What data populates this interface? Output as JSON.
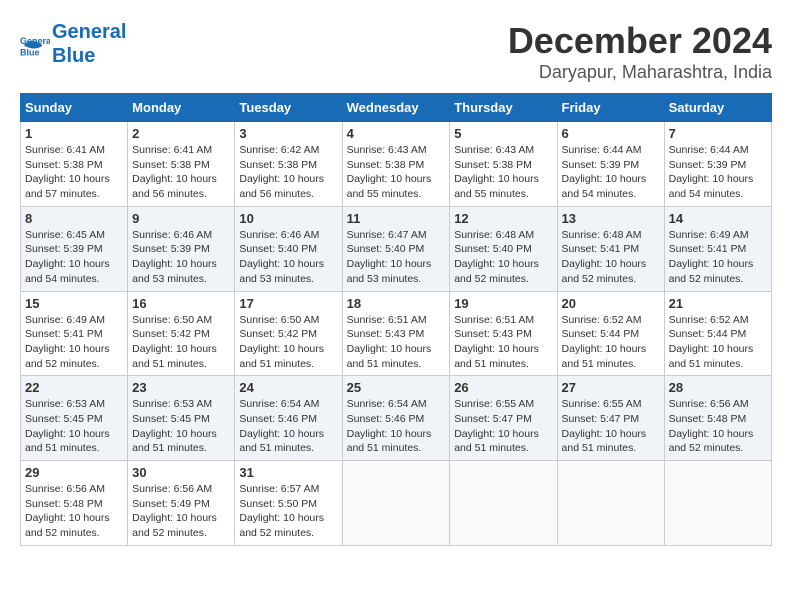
{
  "logo": {
    "line1": "General",
    "line2": "Blue"
  },
  "title": "December 2024",
  "subtitle": "Daryapur, Maharashtra, India",
  "days_of_week": [
    "Sunday",
    "Monday",
    "Tuesday",
    "Wednesday",
    "Thursday",
    "Friday",
    "Saturday"
  ],
  "weeks": [
    [
      {
        "day": "1",
        "sunrise": "6:41 AM",
        "sunset": "5:38 PM",
        "daylight": "10 hours and 57 minutes."
      },
      {
        "day": "2",
        "sunrise": "6:41 AM",
        "sunset": "5:38 PM",
        "daylight": "10 hours and 56 minutes."
      },
      {
        "day": "3",
        "sunrise": "6:42 AM",
        "sunset": "5:38 PM",
        "daylight": "10 hours and 56 minutes."
      },
      {
        "day": "4",
        "sunrise": "6:43 AM",
        "sunset": "5:38 PM",
        "daylight": "10 hours and 55 minutes."
      },
      {
        "day": "5",
        "sunrise": "6:43 AM",
        "sunset": "5:38 PM",
        "daylight": "10 hours and 55 minutes."
      },
      {
        "day": "6",
        "sunrise": "6:44 AM",
        "sunset": "5:39 PM",
        "daylight": "10 hours and 54 minutes."
      },
      {
        "day": "7",
        "sunrise": "6:44 AM",
        "sunset": "5:39 PM",
        "daylight": "10 hours and 54 minutes."
      }
    ],
    [
      {
        "day": "8",
        "sunrise": "6:45 AM",
        "sunset": "5:39 PM",
        "daylight": "10 hours and 54 minutes."
      },
      {
        "day": "9",
        "sunrise": "6:46 AM",
        "sunset": "5:39 PM",
        "daylight": "10 hours and 53 minutes."
      },
      {
        "day": "10",
        "sunrise": "6:46 AM",
        "sunset": "5:40 PM",
        "daylight": "10 hours and 53 minutes."
      },
      {
        "day": "11",
        "sunrise": "6:47 AM",
        "sunset": "5:40 PM",
        "daylight": "10 hours and 53 minutes."
      },
      {
        "day": "12",
        "sunrise": "6:48 AM",
        "sunset": "5:40 PM",
        "daylight": "10 hours and 52 minutes."
      },
      {
        "day": "13",
        "sunrise": "6:48 AM",
        "sunset": "5:41 PM",
        "daylight": "10 hours and 52 minutes."
      },
      {
        "day": "14",
        "sunrise": "6:49 AM",
        "sunset": "5:41 PM",
        "daylight": "10 hours and 52 minutes."
      }
    ],
    [
      {
        "day": "15",
        "sunrise": "6:49 AM",
        "sunset": "5:41 PM",
        "daylight": "10 hours and 52 minutes."
      },
      {
        "day": "16",
        "sunrise": "6:50 AM",
        "sunset": "5:42 PM",
        "daylight": "10 hours and 51 minutes."
      },
      {
        "day": "17",
        "sunrise": "6:50 AM",
        "sunset": "5:42 PM",
        "daylight": "10 hours and 51 minutes."
      },
      {
        "day": "18",
        "sunrise": "6:51 AM",
        "sunset": "5:43 PM",
        "daylight": "10 hours and 51 minutes."
      },
      {
        "day": "19",
        "sunrise": "6:51 AM",
        "sunset": "5:43 PM",
        "daylight": "10 hours and 51 minutes."
      },
      {
        "day": "20",
        "sunrise": "6:52 AM",
        "sunset": "5:44 PM",
        "daylight": "10 hours and 51 minutes."
      },
      {
        "day": "21",
        "sunrise": "6:52 AM",
        "sunset": "5:44 PM",
        "daylight": "10 hours and 51 minutes."
      }
    ],
    [
      {
        "day": "22",
        "sunrise": "6:53 AM",
        "sunset": "5:45 PM",
        "daylight": "10 hours and 51 minutes."
      },
      {
        "day": "23",
        "sunrise": "6:53 AM",
        "sunset": "5:45 PM",
        "daylight": "10 hours and 51 minutes."
      },
      {
        "day": "24",
        "sunrise": "6:54 AM",
        "sunset": "5:46 PM",
        "daylight": "10 hours and 51 minutes."
      },
      {
        "day": "25",
        "sunrise": "6:54 AM",
        "sunset": "5:46 PM",
        "daylight": "10 hours and 51 minutes."
      },
      {
        "day": "26",
        "sunrise": "6:55 AM",
        "sunset": "5:47 PM",
        "daylight": "10 hours and 51 minutes."
      },
      {
        "day": "27",
        "sunrise": "6:55 AM",
        "sunset": "5:47 PM",
        "daylight": "10 hours and 51 minutes."
      },
      {
        "day": "28",
        "sunrise": "6:56 AM",
        "sunset": "5:48 PM",
        "daylight": "10 hours and 52 minutes."
      }
    ],
    [
      {
        "day": "29",
        "sunrise": "6:56 AM",
        "sunset": "5:48 PM",
        "daylight": "10 hours and 52 minutes."
      },
      {
        "day": "30",
        "sunrise": "6:56 AM",
        "sunset": "5:49 PM",
        "daylight": "10 hours and 52 minutes."
      },
      {
        "day": "31",
        "sunrise": "6:57 AM",
        "sunset": "5:50 PM",
        "daylight": "10 hours and 52 minutes."
      },
      null,
      null,
      null,
      null
    ]
  ]
}
